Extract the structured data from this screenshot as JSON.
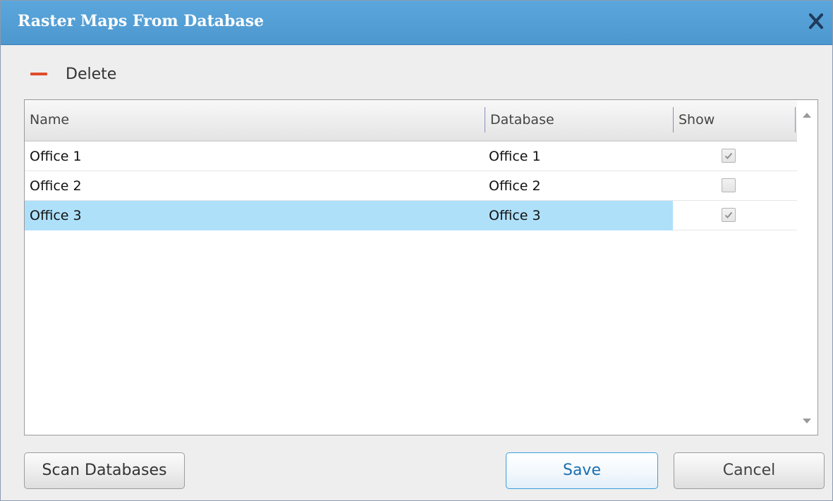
{
  "window": {
    "title": "Raster Maps From Database",
    "close_icon": "close-icon"
  },
  "toolbar": {
    "delete_label": "Delete",
    "delete_icon": "minus-icon"
  },
  "grid": {
    "columns": [
      "Name",
      "Database",
      "Show"
    ],
    "rows": [
      {
        "name": "Office 1",
        "database": "Office 1",
        "show": true,
        "selected": false
      },
      {
        "name": "Office 2",
        "database": "Office 2",
        "show": false,
        "selected": false
      },
      {
        "name": "Office 3",
        "database": "Office 3",
        "show": true,
        "selected": true
      }
    ]
  },
  "buttons": {
    "scan_label": "Scan Databases",
    "save_label": "Save",
    "cancel_label": "Cancel"
  },
  "colors": {
    "titlebar": "#5ba7dc",
    "selection": "#aee0fa",
    "delete_accent": "#e04b2c",
    "primary_button_border": "#3a9fdc"
  }
}
